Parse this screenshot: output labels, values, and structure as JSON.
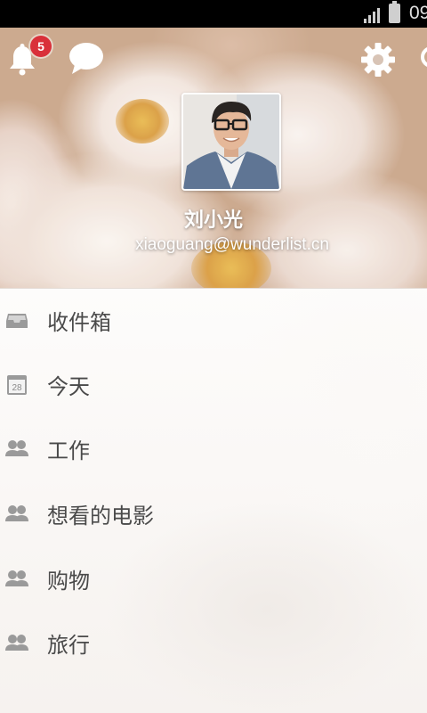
{
  "status_bar": {
    "time": "09"
  },
  "header": {
    "notification_count": "5",
    "user_name": "刘小光",
    "user_email": "xiaoguang@wunderlist.cn"
  },
  "icons": {
    "bell": "bell-icon",
    "chat": "chat-bubble-icon",
    "settings": "gear-icon",
    "inbox": "inbox-icon",
    "today": "calendar-icon",
    "shared_list": "people-icon"
  },
  "colors": {
    "badge": "#d9303a",
    "list_text": "#4a4a4a",
    "icon_gray": "#9a9a9a"
  },
  "lists": [
    {
      "label": "收件箱",
      "icon": "inbox-icon"
    },
    {
      "label": "今天",
      "icon": "calendar-icon",
      "icon_text": "28"
    },
    {
      "label": "工作",
      "icon": "people-icon"
    },
    {
      "label": "想看的电影",
      "icon": "people-icon"
    },
    {
      "label": "购物",
      "icon": "people-icon"
    },
    {
      "label": "旅行",
      "icon": "people-icon"
    }
  ]
}
